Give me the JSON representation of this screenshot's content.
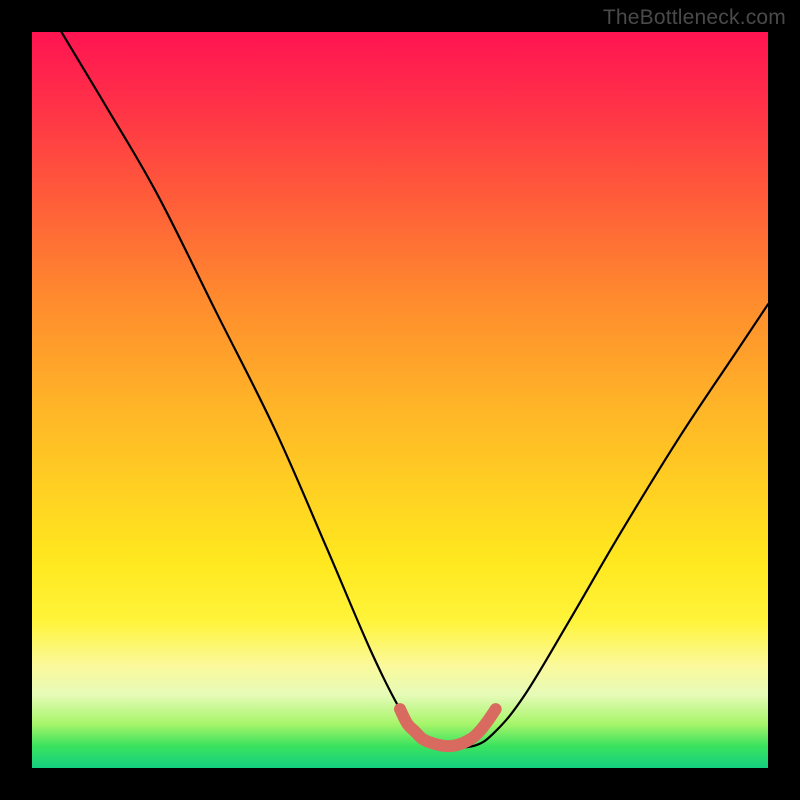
{
  "watermark": "TheBottleneck.com",
  "chart_data": {
    "type": "line",
    "title": "",
    "xlabel": "",
    "ylabel": "",
    "xlim": [
      0,
      100
    ],
    "ylim": [
      0,
      100
    ],
    "grid": false,
    "legend": false,
    "series": [
      {
        "name": "bottleneck-curve",
        "color": "#000000",
        "x": [
          4,
          10,
          17,
          25,
          33,
          40,
          46,
          50,
          53,
          56,
          60,
          63,
          67,
          73,
          80,
          88,
          96,
          100
        ],
        "y": [
          100,
          90,
          78,
          62,
          46,
          30,
          16,
          8,
          4,
          3,
          3,
          5,
          10,
          20,
          32,
          45,
          57,
          63
        ]
      },
      {
        "name": "optimal-range-marker",
        "color": "#d96a60",
        "x": [
          50,
          51,
          52,
          53,
          54,
          55,
          56,
          57,
          58,
          59,
          60,
          61,
          62,
          63
        ],
        "y": [
          8,
          6,
          5,
          4,
          3.5,
          3.2,
          3,
          3,
          3.2,
          3.6,
          4.2,
          5.2,
          6.5,
          8
        ]
      }
    ],
    "background_gradient": {
      "direction": "top-to-bottom",
      "stops": [
        {
          "pos": 0,
          "color": "#ff1452"
        },
        {
          "pos": 22,
          "color": "#ff5a3a"
        },
        {
          "pos": 50,
          "color": "#ffb228"
        },
        {
          "pos": 72,
          "color": "#ffe81f"
        },
        {
          "pos": 90,
          "color": "#e6fbb8"
        },
        {
          "pos": 100,
          "color": "#14cf80"
        }
      ]
    }
  }
}
